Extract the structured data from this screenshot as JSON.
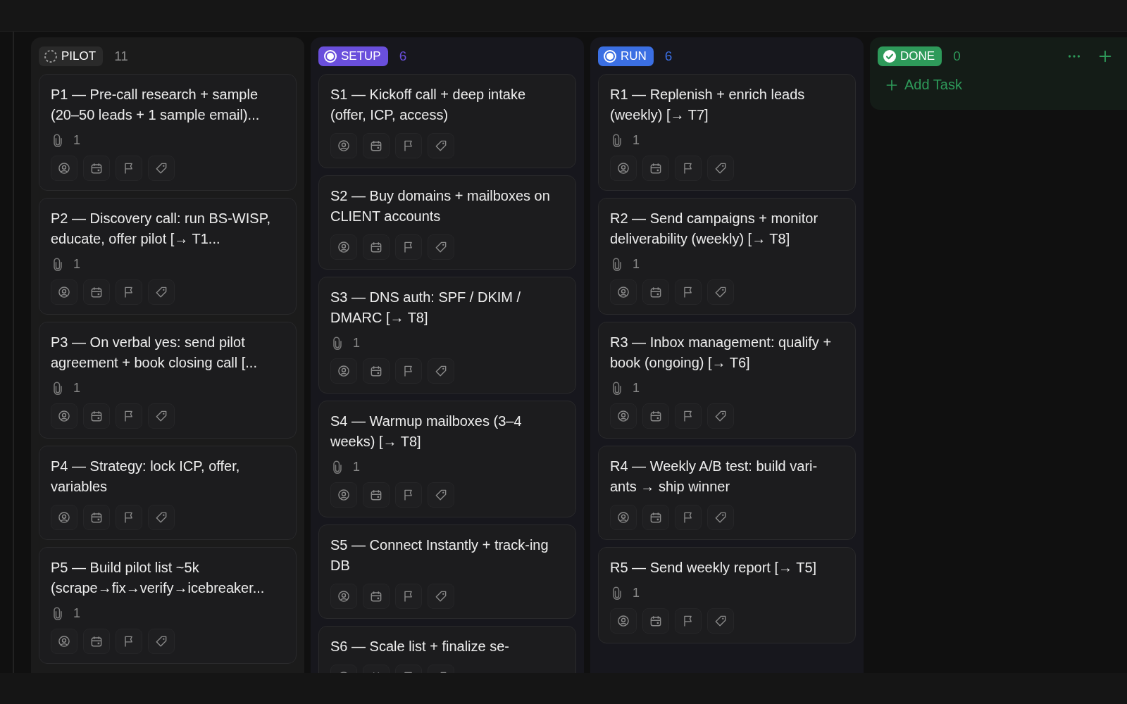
{
  "columns": [
    {
      "status": "PILOT",
      "kind": "dashed",
      "color": "#2a2a2a",
      "count": "11",
      "cards": [
        {
          "title": "P1 — Pre-call research + sample (20–50 leads + 1 sample email)...",
          "attachments": "1"
        },
        {
          "title": "P2 — Discovery call: run BS-WISP, educate, offer pilot [→ T1...",
          "attachments": "1"
        },
        {
          "title": "P3 — On verbal yes: send pilot agreement + book closing call [...",
          "attachments": "1"
        },
        {
          "title": "P4 — Strategy: lock ICP, offer, variables"
        },
        {
          "title": "P5 — Build pilot list ~5k (scrape→fix→verify→icebreaker...",
          "attachments": "1"
        }
      ]
    },
    {
      "status": "SETUP",
      "kind": "ring",
      "color": "#6a4fdc",
      "count": "6",
      "cards": [
        {
          "title": "S1 — Kickoff call + deep intake (offer, ICP, access)"
        },
        {
          "title": "S2 — Buy domains + mailboxes on CLIENT accounts"
        },
        {
          "title": "S3 — DNS auth: SPF / DKIM / DMARC [→ T8]",
          "attachments": "1"
        },
        {
          "title": "S4 — Warmup mailboxes (3–4 weeks) [→ T8]",
          "attachments": "1"
        },
        {
          "title": "S5 — Connect Instantly + track-ing DB"
        },
        {
          "title": "S6 — Scale list + finalize se-"
        }
      ]
    },
    {
      "status": "RUN",
      "kind": "ring",
      "color": "#3b6fe3",
      "count": "6",
      "cards": [
        {
          "title": "R1 — Replenish + enrich leads (weekly) [→ T7]",
          "attachments": "1"
        },
        {
          "title": "R2 — Send campaigns + monitor deliverability (weekly) [→ T8]",
          "attachments": "1"
        },
        {
          "title": "R3 — Inbox management: qualify + book (ongoing) [→ T6]",
          "attachments": "1"
        },
        {
          "title": "R4 — Weekly A/B test: build vari-ants → ship winner"
        },
        {
          "title": "R5 — Send weekly report [→ T5]",
          "attachments": "1"
        }
      ]
    },
    {
      "status": "DONE",
      "kind": "check",
      "color": "#2e9a5a",
      "count": "0",
      "add_task": "Add Task"
    }
  ]
}
